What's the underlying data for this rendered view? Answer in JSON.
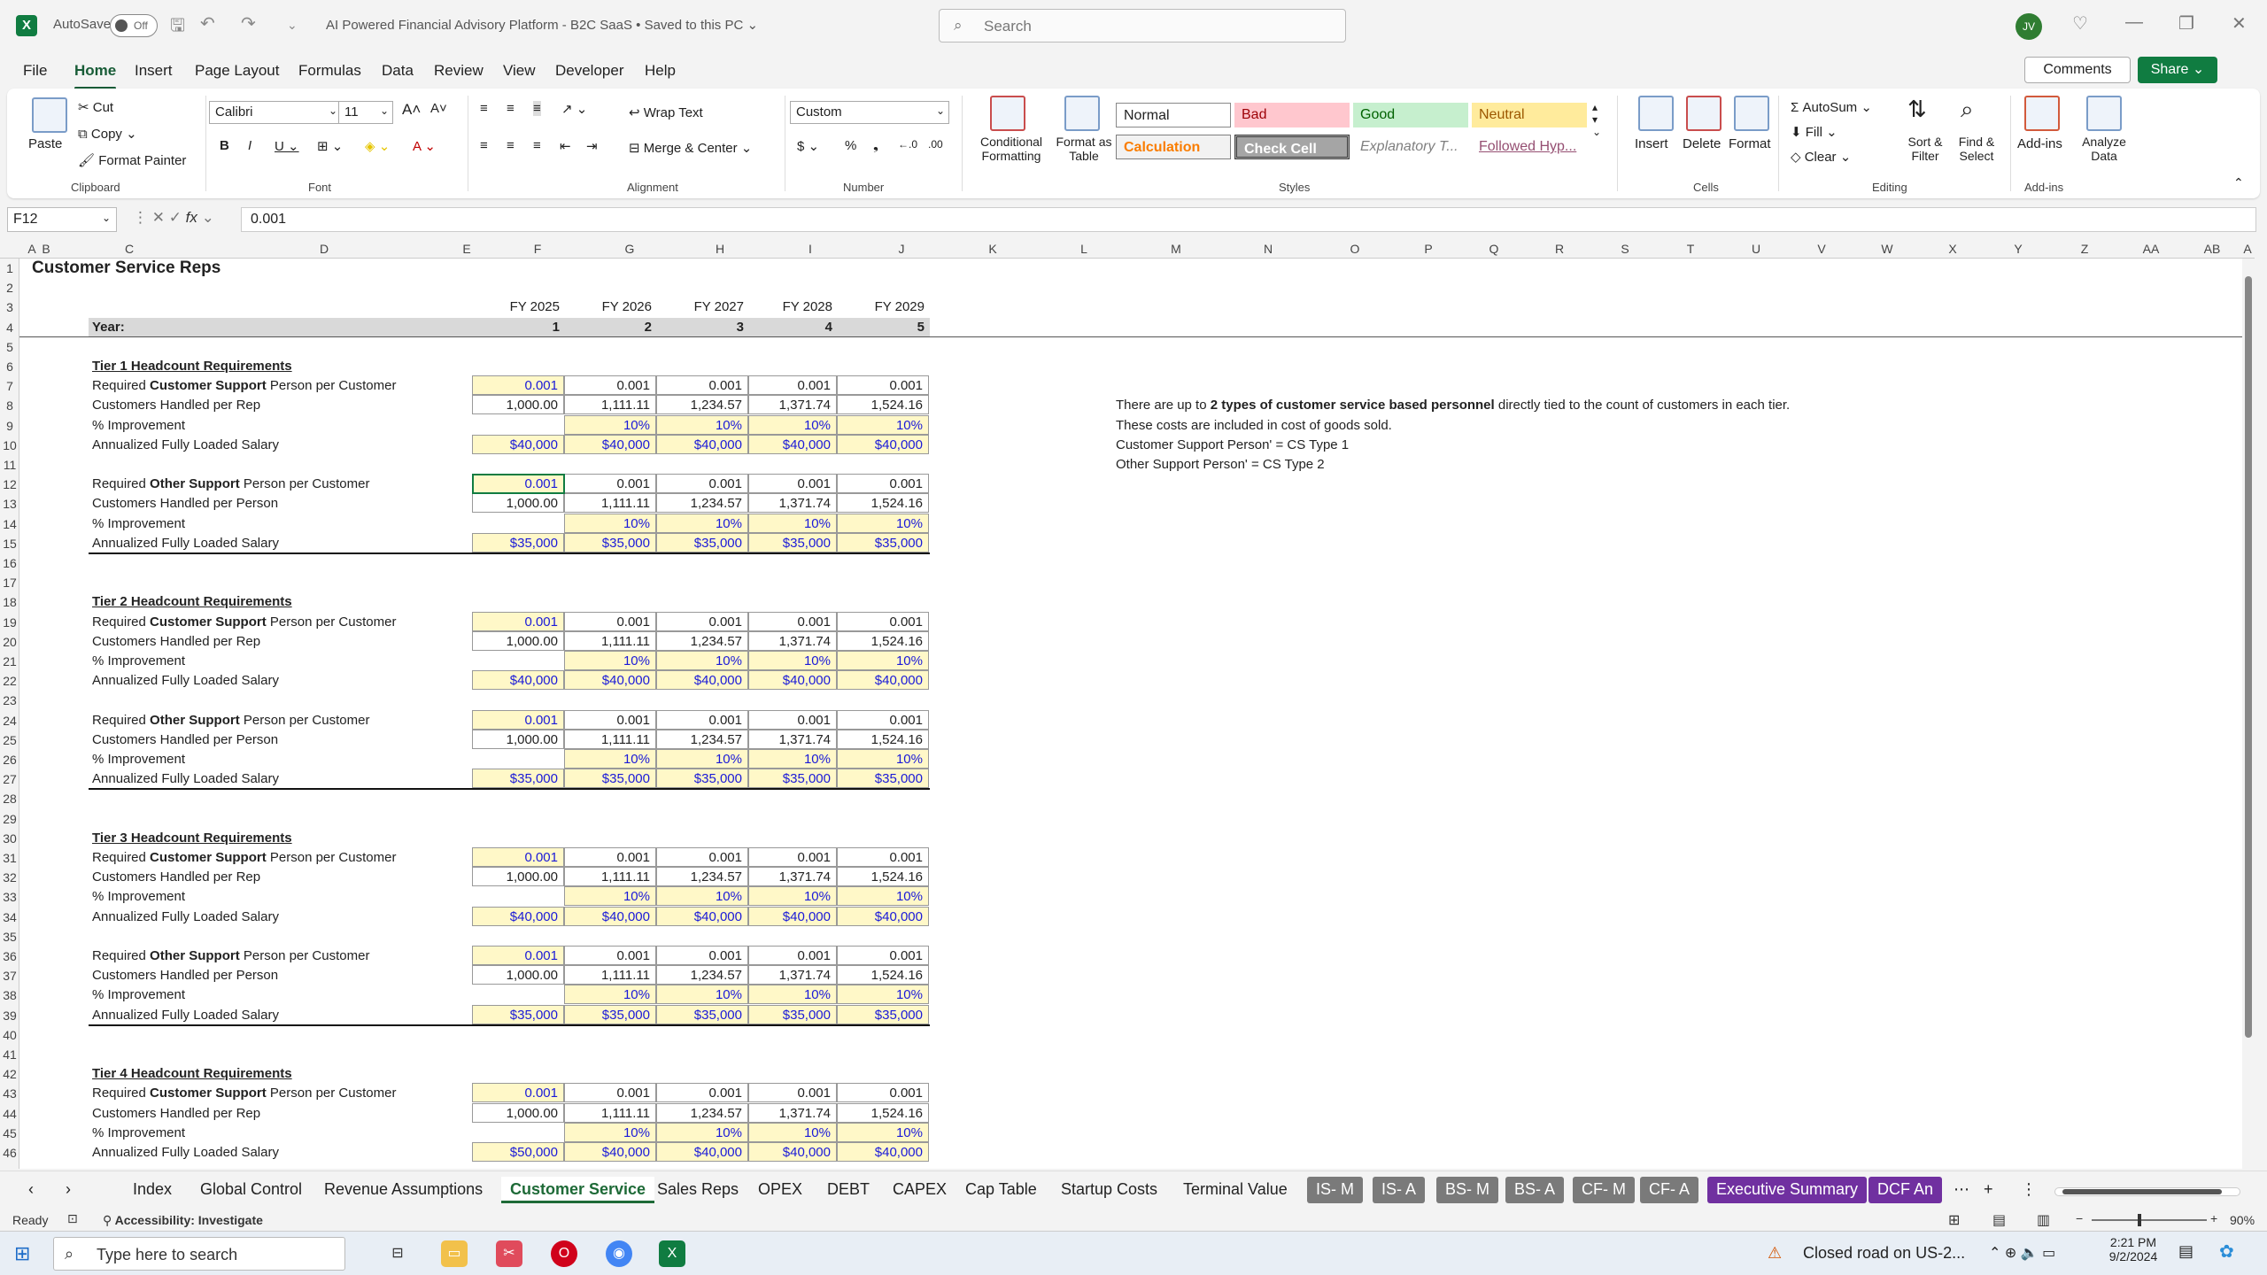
{
  "app": {
    "autosave_label": "AutoSave",
    "autosave_state": "Off",
    "doc_title": "AI Powered Financial Advisory Platform - B2C SaaS • Saved to this PC ⌄",
    "search_placeholder": "Search",
    "user_initials": "JV",
    "accent": "#107c41"
  },
  "menu": [
    "File",
    "Home",
    "Insert",
    "Page Layout",
    "Formulas",
    "Data",
    "Review",
    "View",
    "Developer",
    "Help"
  ],
  "menu_active": "Home",
  "header_buttons": {
    "comments": "Comments",
    "share": "Share ⌄"
  },
  "ribbon": {
    "clipboard": {
      "paste": "Paste",
      "cut": "Cut",
      "copy": "Copy",
      "format_painter": "Format Painter",
      "label": "Clipboard"
    },
    "font": {
      "name": "Calibri",
      "size": "11",
      "label": "Font"
    },
    "alignment": {
      "wrap": "Wrap Text",
      "merge": "Merge & Center",
      "label": "Alignment"
    },
    "number": {
      "format": "Custom",
      "label": "Number"
    },
    "styles": {
      "cond": "Conditional Formatting",
      "table": "Format as Table",
      "normal": "Normal",
      "bad": "Bad",
      "good": "Good",
      "neutral": "Neutral",
      "calculation": "Calculation",
      "check": "Check Cell",
      "explanatory": "Explanatory T...",
      "followed": "Followed Hyp...",
      "label": "Styles"
    },
    "cells": {
      "insert": "Insert",
      "delete": "Delete",
      "format": "Format",
      "label": "Cells"
    },
    "editing": {
      "autosum": "AutoSum",
      "fill": "Fill",
      "clear": "Clear",
      "sort": "Sort & Filter",
      "find": "Find & Select",
      "label": "Editing"
    },
    "addins": {
      "addins": "Add-ins",
      "analyze": "Analyze Data",
      "label": "Add-ins"
    }
  },
  "formula_bar": {
    "cell": "F12",
    "value": "0.001"
  },
  "columns": [
    "A",
    "B",
    "C",
    "D",
    "E",
    "F",
    "G",
    "H",
    "I",
    "J",
    "K",
    "L",
    "M",
    "N",
    "O",
    "P",
    "Q",
    "R",
    "S",
    "T",
    "U",
    "V",
    "W",
    "X",
    "Y",
    "Z",
    "AA",
    "AB",
    "A"
  ],
  "sheet": {
    "title": "Customer Service Reps",
    "year_label": "Year:",
    "fy": [
      "FY 2025",
      "FY 2026",
      "FY 2027",
      "FY 2028",
      "FY 2029"
    ],
    "years": [
      "1",
      "2",
      "3",
      "4",
      "5"
    ],
    "tiers": [
      {
        "title": "Tier 1 Headcount Requirements",
        "cs_salary": [
          "$40,000",
          "$40,000",
          "$40,000",
          "$40,000",
          "$40,000"
        ],
        "os_salary": [
          "$35,000",
          "$35,000",
          "$35,000",
          "$35,000",
          "$35,000"
        ]
      },
      {
        "title": "Tier 2 Headcount Requirements",
        "cs_salary": [
          "$40,000",
          "$40,000",
          "$40,000",
          "$40,000",
          "$40,000"
        ],
        "os_salary": [
          "$35,000",
          "$35,000",
          "$35,000",
          "$35,000",
          "$35,000"
        ]
      },
      {
        "title": "Tier 3 Headcount Requirements",
        "cs_salary": [
          "$40,000",
          "$40,000",
          "$40,000",
          "$40,000",
          "$40,000"
        ],
        "os_salary": [
          "$35,000",
          "$35,000",
          "$35,000",
          "$35,000",
          "$35,000"
        ]
      },
      {
        "title": "Tier 4 Headcount Requirements",
        "cs_salary": [
          "$50,000",
          "$40,000",
          "$40,000",
          "$40,000",
          "$40,000"
        ],
        "os_salary": []
      }
    ],
    "labels": {
      "req_prefix": "Required ",
      "cs_bold": "Customer Support",
      "os_bold": "Other Support",
      "req_suffix": " Person per Customer",
      "handled_rep": "Customers Handled per Rep",
      "handled_person": "Customers Handled per Person",
      "improvement": "% Improvement",
      "salary": "Annualized Fully Loaded Salary"
    },
    "person_per_customer": [
      "0.001",
      "0.001",
      "0.001",
      "0.001",
      "0.001"
    ],
    "handled": [
      "1,000.00",
      "1,111.11",
      "1,234.57",
      "1,371.74",
      "1,524.16"
    ],
    "improvement": [
      "",
      "10%",
      "10%",
      "10%",
      "10%"
    ],
    "notes": {
      "line1_a": "There are up to ",
      "line1_b": "2 types of customer service based personnel",
      "line1_c": " directly tied to the count of customers in each tier.",
      "line2": "These costs are included in cost of goods sold.",
      "line3": "Customer Support Person' = CS Type 1",
      "line4": "Other Support Person' = CS Type 2"
    }
  },
  "sheet_tabs": [
    {
      "label": "Index",
      "style": "plain"
    },
    {
      "label": "Global Control",
      "style": "plain"
    },
    {
      "label": "Revenue Assumptions",
      "style": "plain"
    },
    {
      "label": "Customer Service",
      "style": "active"
    },
    {
      "label": "Sales Reps",
      "style": "plain"
    },
    {
      "label": "OPEX",
      "style": "plain"
    },
    {
      "label": "DEBT",
      "style": "plain"
    },
    {
      "label": "CAPEX",
      "style": "plain"
    },
    {
      "label": "Cap Table",
      "style": "plain"
    },
    {
      "label": "Startup Costs",
      "style": "plain"
    },
    {
      "label": "Terminal Value",
      "style": "plain"
    },
    {
      "label": "IS- M",
      "style": "gray"
    },
    {
      "label": "IS- A",
      "style": "gray"
    },
    {
      "label": "BS- M",
      "style": "gray"
    },
    {
      "label": "BS- A",
      "style": "gray"
    },
    {
      "label": "CF- M",
      "style": "gray"
    },
    {
      "label": "CF- A",
      "style": "gray"
    },
    {
      "label": "Executive Summary",
      "style": "purple"
    },
    {
      "label": "DCF An",
      "style": "purple"
    }
  ],
  "status": {
    "ready": "Ready",
    "accessibility": "Accessibility: Investigate",
    "zoom": "90%"
  },
  "taskbar": {
    "search": "Type here to search",
    "notice": "Closed road on US-2...",
    "time": "2:21 PM",
    "date": "9/2/2024"
  }
}
